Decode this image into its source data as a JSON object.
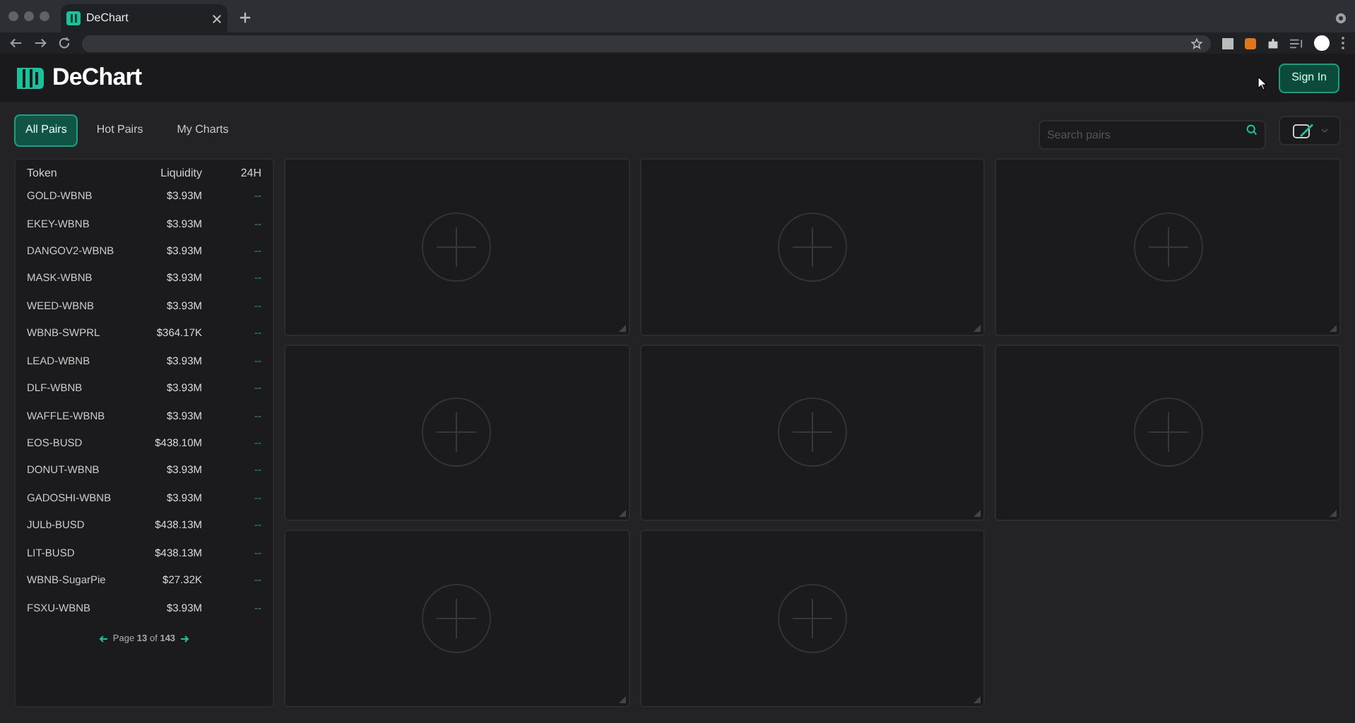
{
  "browser": {
    "tab_title": "DeChart"
  },
  "header": {
    "logo": "DeChart",
    "sign_in": "Sign In"
  },
  "tabs": [
    {
      "label": "All Pairs",
      "selected": true
    },
    {
      "label": "Hot Pairs",
      "selected": false
    },
    {
      "label": "My Charts",
      "selected": false
    }
  ],
  "search": {
    "placeholder": "Search pairs"
  },
  "table": {
    "columns": [
      "Token",
      "Liquidity",
      "24H"
    ],
    "rows": [
      {
        "token": "GOLD-WBNB",
        "liquidity": "$3.93M",
        "change": "--"
      },
      {
        "token": "EKEY-WBNB",
        "liquidity": "$3.93M",
        "change": "--"
      },
      {
        "token": "DANGOV2-WBNB",
        "liquidity": "$3.93M",
        "change": "--"
      },
      {
        "token": "MASK-WBNB",
        "liquidity": "$3.93M",
        "change": "--"
      },
      {
        "token": "WEED-WBNB",
        "liquidity": "$3.93M",
        "change": "--"
      },
      {
        "token": "WBNB-SWPRL",
        "liquidity": "$364.17K",
        "change": "--"
      },
      {
        "token": "LEAD-WBNB",
        "liquidity": "$3.93M",
        "change": "--"
      },
      {
        "token": "DLF-WBNB",
        "liquidity": "$3.93M",
        "change": "--"
      },
      {
        "token": "WAFFLE-WBNB",
        "liquidity": "$3.93M",
        "change": "--"
      },
      {
        "token": "EOS-BUSD",
        "liquidity": "$438.10M",
        "change": "--"
      },
      {
        "token": "DONUT-WBNB",
        "liquidity": "$3.93M",
        "change": "--"
      },
      {
        "token": "GADOSHI-WBNB",
        "liquidity": "$3.93M",
        "change": "--"
      },
      {
        "token": "JULb-BUSD",
        "liquidity": "$438.13M",
        "change": "--"
      },
      {
        "token": "LIT-BUSD",
        "liquidity": "$438.13M",
        "change": "--"
      },
      {
        "token": "WBNB-SugarPie",
        "liquidity": "$27.32K",
        "change": "--"
      },
      {
        "token": "FSXU-WBNB",
        "liquidity": "$3.93M",
        "change": "--"
      }
    ],
    "pagination": "Page **13** of **143**"
  },
  "chart_slots": [
    {
      "kind": "empty"
    },
    {
      "kind": "empty"
    },
    {
      "kind": "empty"
    },
    {
      "kind": "empty"
    },
    {
      "kind": "empty"
    },
    {
      "kind": "empty"
    },
    {
      "kind": "empty"
    },
    {
      "kind": "empty"
    }
  ]
}
